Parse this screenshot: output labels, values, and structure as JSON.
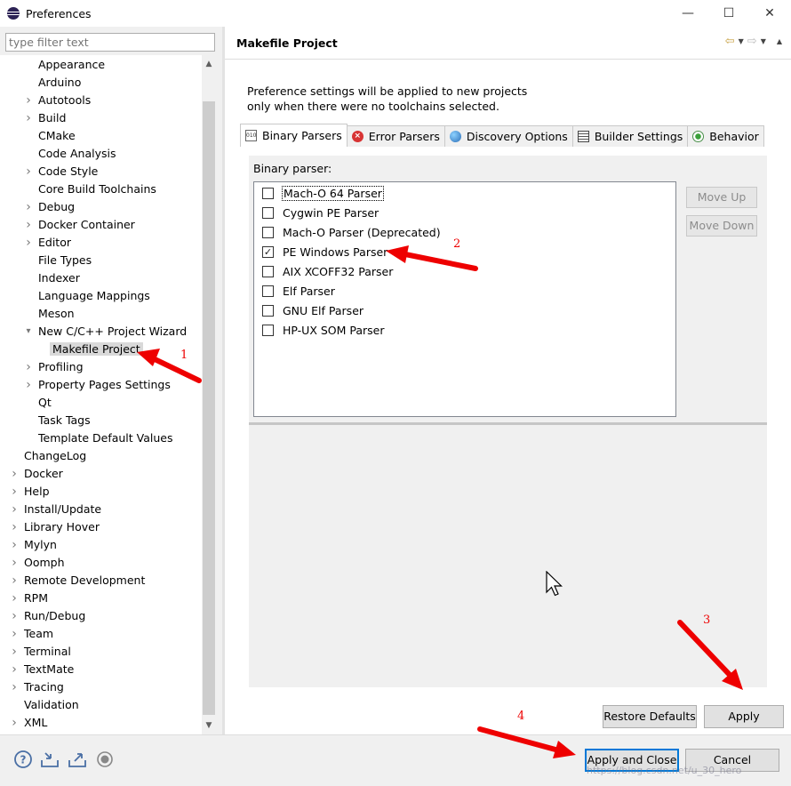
{
  "window": {
    "title": "Preferences",
    "minimize": "—",
    "maximize": "☐",
    "close": "✕"
  },
  "filter": {
    "placeholder": "type filter text"
  },
  "tree": [
    {
      "label": "Appearance",
      "indent": 2,
      "arrow": ""
    },
    {
      "label": "Arduino",
      "indent": 2,
      "arrow": ""
    },
    {
      "label": "Autotools",
      "indent": 2,
      "arrow": "›"
    },
    {
      "label": "Build",
      "indent": 2,
      "arrow": "›"
    },
    {
      "label": "CMake",
      "indent": 2,
      "arrow": ""
    },
    {
      "label": "Code Analysis",
      "indent": 2,
      "arrow": ""
    },
    {
      "label": "Code Style",
      "indent": 2,
      "arrow": "›"
    },
    {
      "label": "Core Build Toolchains",
      "indent": 2,
      "arrow": ""
    },
    {
      "label": "Debug",
      "indent": 2,
      "arrow": "›"
    },
    {
      "label": "Docker Container",
      "indent": 2,
      "arrow": "›"
    },
    {
      "label": "Editor",
      "indent": 2,
      "arrow": "›"
    },
    {
      "label": "File Types",
      "indent": 2,
      "arrow": ""
    },
    {
      "label": "Indexer",
      "indent": 2,
      "arrow": ""
    },
    {
      "label": "Language Mappings",
      "indent": 2,
      "arrow": ""
    },
    {
      "label": "Meson",
      "indent": 2,
      "arrow": ""
    },
    {
      "label": "New C/C++ Project Wizard",
      "indent": 2,
      "arrow": "⌄"
    },
    {
      "label": "Makefile Project",
      "indent": 3,
      "arrow": "",
      "selected": true
    },
    {
      "label": "Profiling",
      "indent": 2,
      "arrow": "›"
    },
    {
      "label": "Property Pages Settings",
      "indent": 2,
      "arrow": "›"
    },
    {
      "label": "Qt",
      "indent": 2,
      "arrow": ""
    },
    {
      "label": "Task Tags",
      "indent": 2,
      "arrow": ""
    },
    {
      "label": "Template Default Values",
      "indent": 2,
      "arrow": ""
    },
    {
      "label": "ChangeLog",
      "indent": 1,
      "arrow": ""
    },
    {
      "label": "Docker",
      "indent": 1,
      "arrow": "›"
    },
    {
      "label": "Help",
      "indent": 1,
      "arrow": "›"
    },
    {
      "label": "Install/Update",
      "indent": 1,
      "arrow": "›"
    },
    {
      "label": "Library Hover",
      "indent": 1,
      "arrow": "›"
    },
    {
      "label": "Mylyn",
      "indent": 1,
      "arrow": "›"
    },
    {
      "label": "Oomph",
      "indent": 1,
      "arrow": "›"
    },
    {
      "label": "Remote Development",
      "indent": 1,
      "arrow": "›"
    },
    {
      "label": "RPM",
      "indent": 1,
      "arrow": "›"
    },
    {
      "label": "Run/Debug",
      "indent": 1,
      "arrow": "›"
    },
    {
      "label": "Team",
      "indent": 1,
      "arrow": "›"
    },
    {
      "label": "Terminal",
      "indent": 1,
      "arrow": "›"
    },
    {
      "label": "TextMate",
      "indent": 1,
      "arrow": "›"
    },
    {
      "label": "Tracing",
      "indent": 1,
      "arrow": "›"
    },
    {
      "label": "Validation",
      "indent": 1,
      "arrow": ""
    },
    {
      "label": "XML",
      "indent": 1,
      "arrow": "›"
    }
  ],
  "page": {
    "title": "Makefile Project",
    "info_line1": "Preference settings will be applied to new projects",
    "info_line2": "only when there were no toolchains selected."
  },
  "tabs": [
    {
      "label": "Binary Parsers",
      "icon": "binary-icon",
      "active": true
    },
    {
      "label": "Error Parsers",
      "icon": "error-icon",
      "active": false
    },
    {
      "label": "Discovery Options",
      "icon": "globe-icon",
      "active": false
    },
    {
      "label": "Builder Settings",
      "icon": "document-icon",
      "active": false
    },
    {
      "label": "Behavior",
      "icon": "radio-icon",
      "active": false
    }
  ],
  "binary_parser": {
    "label": "Binary parser:",
    "items": [
      {
        "label": "Mach-O 64 Parser",
        "checked": false,
        "focused": true
      },
      {
        "label": "Cygwin PE Parser",
        "checked": false
      },
      {
        "label": "Mach-O Parser (Deprecated)",
        "checked": false
      },
      {
        "label": "PE Windows Parser",
        "checked": true
      },
      {
        "label": "AIX XCOFF32 Parser",
        "checked": false
      },
      {
        "label": "Elf Parser",
        "checked": false
      },
      {
        "label": "GNU Elf Parser",
        "checked": false
      },
      {
        "label": "HP-UX SOM Parser",
        "checked": false
      }
    ],
    "move_up": "Move Up",
    "move_down": "Move Down"
  },
  "buttons": {
    "restore_defaults": "Restore Defaults",
    "apply": "Apply",
    "apply_and_close": "Apply and Close",
    "cancel": "Cancel"
  },
  "annotations": [
    "1",
    "2",
    "3",
    "4"
  ],
  "watermark": "https://blog.csdn.net/u_30_hero",
  "colors": {
    "annotation": "#ee0000",
    "default_button_border": "#0078d7",
    "selection": "#d9d9d9"
  }
}
